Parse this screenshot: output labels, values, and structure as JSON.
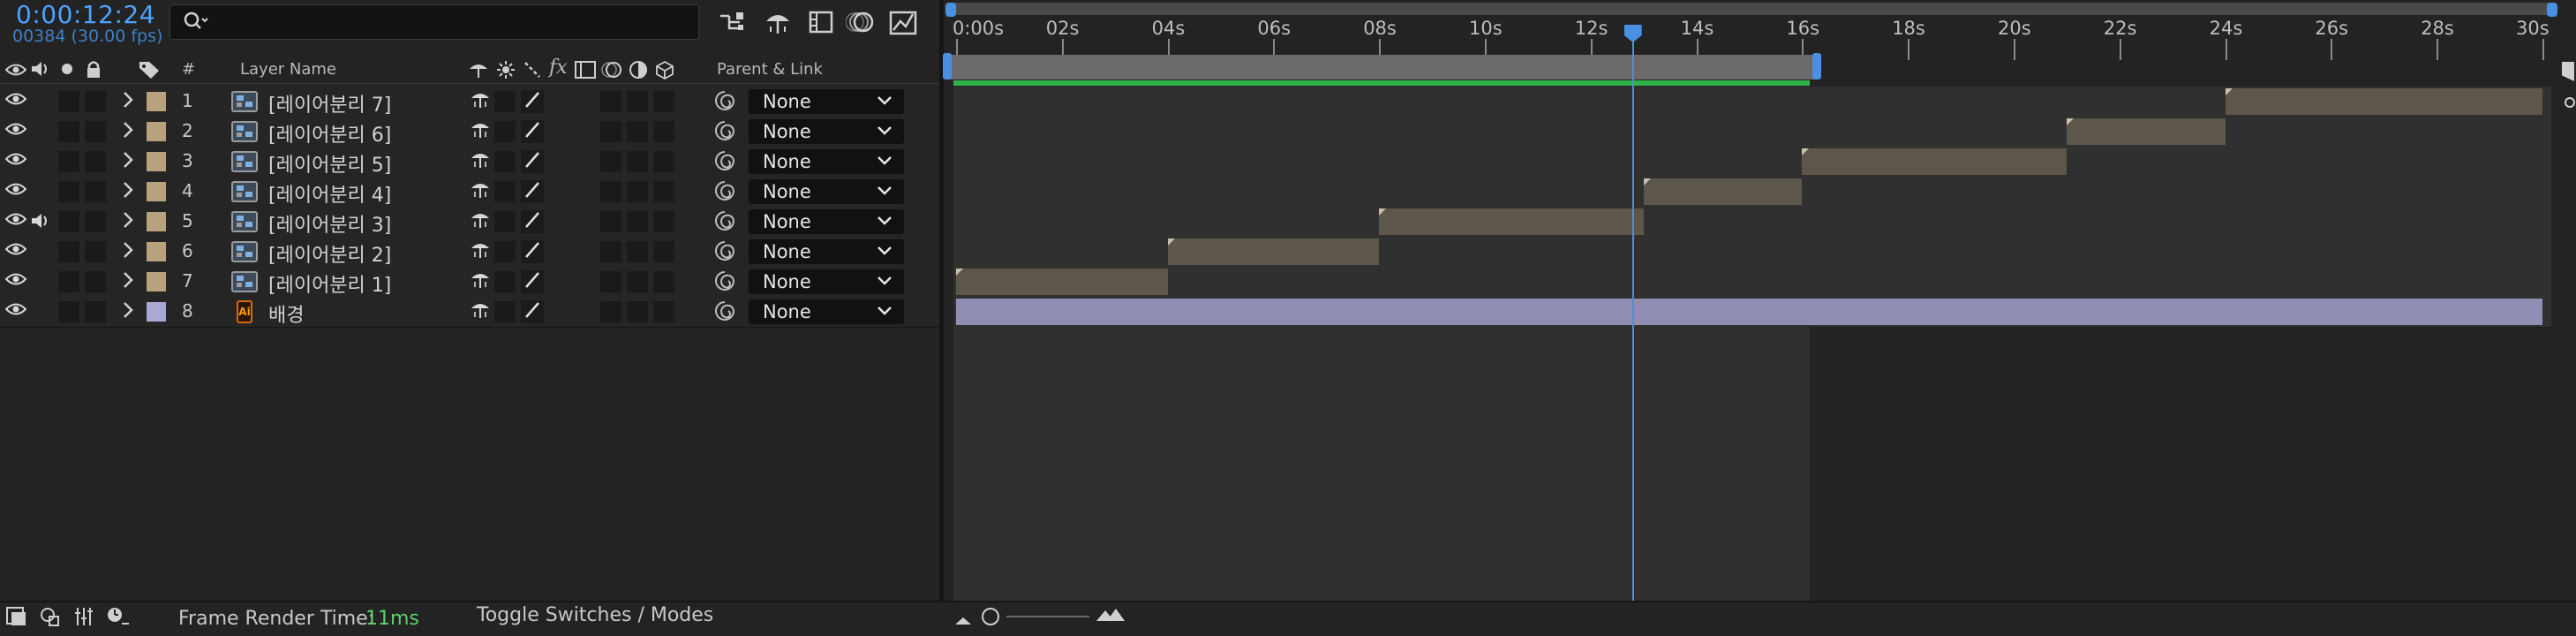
{
  "header": {
    "timecode": "0:00:12:24",
    "subcode": "00384 (30.00 fps)",
    "search": {
      "value": "",
      "placeholder": ""
    }
  },
  "icons": {
    "search": "search-icon",
    "toolbar": [
      "composition-flowchart-icon",
      "shy-layers-icon",
      "frame-blending-icon",
      "motion-blur-icon",
      "graph-editor-icon"
    ]
  },
  "columns": {
    "hash": "#",
    "layer_name": "Layer Name",
    "parent_link": "Parent & Link",
    "fx": "fx"
  },
  "layers": [
    {
      "num": "1",
      "name": "[레이어분리 7]",
      "type": "footage",
      "label_color": "#b8a27d",
      "parent": "None",
      "audio": false,
      "start": 24.0,
      "end": 30.0
    },
    {
      "num": "2",
      "name": "[레이어분리 6]",
      "type": "footage",
      "label_color": "#b8a27d",
      "parent": "None",
      "audio": false,
      "start": 21.0,
      "end": 24.0
    },
    {
      "num": "3",
      "name": "[레이어분리 5]",
      "type": "footage",
      "label_color": "#b8a27d",
      "parent": "None",
      "audio": false,
      "start": 16.0,
      "end": 21.0
    },
    {
      "num": "4",
      "name": "[레이어분리 4]",
      "type": "footage",
      "label_color": "#b8a27d",
      "parent": "None",
      "audio": false,
      "start": 13.0,
      "end": 16.0
    },
    {
      "num": "5",
      "name": "[레이어분리 3]",
      "type": "footage",
      "label_color": "#b8a27d",
      "parent": "None",
      "audio": true,
      "start": 8.0,
      "end": 13.0
    },
    {
      "num": "6",
      "name": "[레이어분리 2]",
      "type": "footage",
      "label_color": "#b8a27d",
      "parent": "None",
      "audio": false,
      "start": 4.0,
      "end": 8.0
    },
    {
      "num": "7",
      "name": "[레이어분리 1]",
      "type": "footage",
      "label_color": "#b8a27d",
      "parent": "None",
      "audio": false,
      "start": 0.0,
      "end": 4.0
    },
    {
      "num": "8",
      "name": "배경",
      "type": "illustrator",
      "icon_text": "Ai",
      "label_color": "#a9a9d6",
      "parent": "None",
      "audio": false,
      "start": 0.0,
      "end": 30.0
    }
  ],
  "timeline": {
    "ruler_labels": [
      "0:00s",
      "02s",
      "04s",
      "06s",
      "08s",
      "10s",
      "12s",
      "14s",
      "16s",
      "18s",
      "20s",
      "22s",
      "24s",
      "26s",
      "28s",
      "30s"
    ],
    "duration_s": 30,
    "current_time_s": 12.8,
    "work_area_end_s": 16.0
  },
  "footer": {
    "frame_render_label": "Frame Render Time:",
    "frame_render_value": "11ms",
    "toggle_label": "Toggle Switches / Modes"
  },
  "colors": {
    "accent": "#4a90e2",
    "work_area_bar": "#31b34a",
    "render_time": "#5ed06a",
    "layer_bar": "#5d564a",
    "bg_layer_bar": "#8f8fb4"
  }
}
